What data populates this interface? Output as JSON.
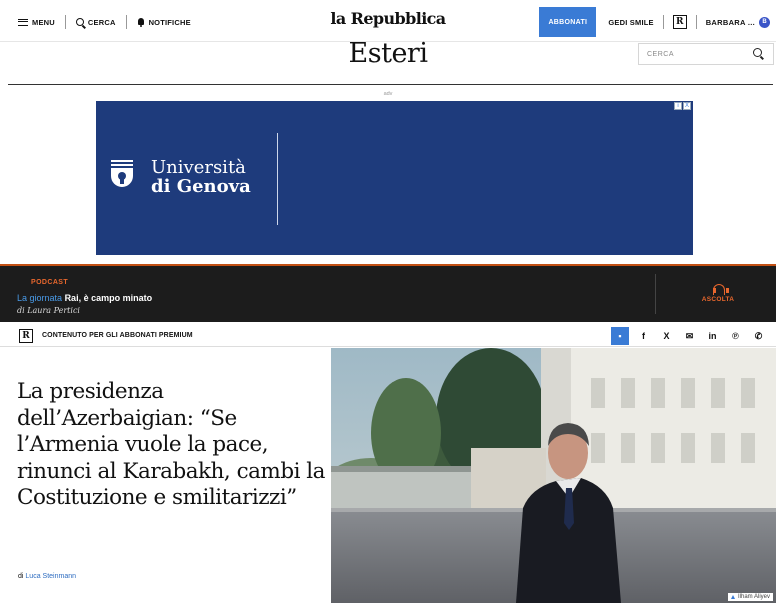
{
  "topbar": {
    "menu_label": "MENU",
    "search_label": "CERCA",
    "notifications_label": "NOTIFICHE",
    "logo": "la Repubblica",
    "subscribe_label": "ABBONATI",
    "gedi_label": "GEDI SMILE",
    "r_badge": "R",
    "user_name": "BARBARA ...",
    "user_initial": "B"
  },
  "section": {
    "title": "Esteri",
    "search_placeholder": "CERCA"
  },
  "ad": {
    "label": "adv",
    "close_i": "i",
    "close_x": "X",
    "university_line1": "Università",
    "university_line2": "di Genova"
  },
  "podcast": {
    "label": "PODCAST",
    "program": "La giornata",
    "title": "Rai, è campo minato",
    "author": "di Laura Pertici",
    "listen_label": "ASCOLTA"
  },
  "premium": {
    "badge": "R",
    "text": "CONTENUTO PER GLI ABBONATI PREMIUM"
  },
  "share": {
    "comment": "▪",
    "facebook": "f",
    "x": "X",
    "email": "✉",
    "linkedin": "in",
    "pinterest": "℗",
    "whatsapp": "✆"
  },
  "article": {
    "headline": "La presidenza dell’Azerbaigian: “Se l’Armenia vuole la pace, rinunci al Karabakh, cambi la Costituzione e smilitarizzi”",
    "byline_prefix": "di",
    "author": "Luca Steinmann",
    "photo_caption": "Ilham Aliyev"
  },
  "colors": {
    "accent_blue": "#3a7bd5",
    "ad_navy": "#1e3b7c",
    "podcast_orange": "#e8672d",
    "podcast_bg": "#1c1c1c"
  }
}
